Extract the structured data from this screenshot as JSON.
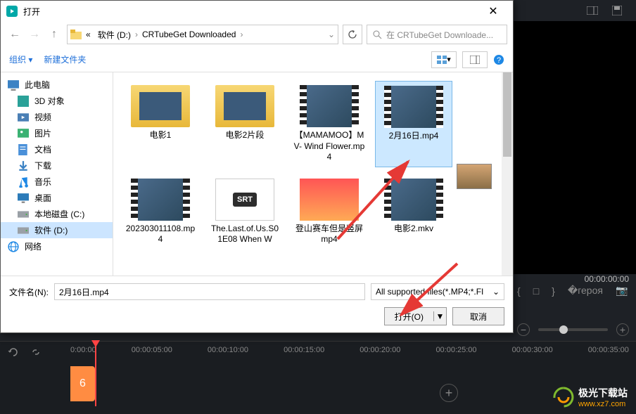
{
  "dialog": {
    "title": "打开",
    "path": {
      "drive_glyph": "«",
      "drive": "软件 (D:)",
      "folder": "CRTubeGet Downloaded"
    },
    "search_placeholder": "在 CRTubeGet Downloade...",
    "toolbar": {
      "organize": "组织",
      "new_folder": "新建文件夹"
    },
    "sidebar": [
      {
        "label": "此电脑",
        "icon": "pc",
        "lvl": 1
      },
      {
        "label": "3D 对象",
        "icon": "3d"
      },
      {
        "label": "视频",
        "icon": "video"
      },
      {
        "label": "图片",
        "icon": "image"
      },
      {
        "label": "文档",
        "icon": "doc"
      },
      {
        "label": "下载",
        "icon": "download"
      },
      {
        "label": "音乐",
        "icon": "music"
      },
      {
        "label": "桌面",
        "icon": "desktop"
      },
      {
        "label": "本地磁盘 (C:)",
        "icon": "disk"
      },
      {
        "label": "软件 (D:)",
        "icon": "disk",
        "selected": true
      },
      {
        "label": "网络",
        "icon": "net",
        "lvl": 1
      }
    ],
    "files": [
      {
        "label": "电影1",
        "type": "folder"
      },
      {
        "label": "电影2片段",
        "type": "folder"
      },
      {
        "label": "【MAMAMOO】MV- Wind Flower.mp4",
        "type": "video"
      },
      {
        "label": "2月16日.mp4",
        "type": "video",
        "selected": true
      },
      {
        "label": "202303011108.mp4",
        "type": "video"
      },
      {
        "label": "The.Last.of.Us.S01E08 When W",
        "type": "srt"
      },
      {
        "label": "登山赛车但是竖屏   mp4",
        "type": "image"
      },
      {
        "label": "电影2.mkv",
        "type": "video"
      }
    ],
    "filename_label": "文件名(N):",
    "filename_value": "2月16日.mp4",
    "filter": "All supported files(*.MP4;*.FI",
    "open_btn": "打开(O)",
    "cancel_btn": "取消"
  },
  "editor": {
    "quality": "质",
    "timecode": "00:00:00:00",
    "ticks": [
      "0:00:00",
      "00:00:05:00",
      "00:00:10:00",
      "00:00:15:00",
      "00:00:20:00",
      "00:00:25:00",
      "00:00:30:00",
      "00:00:35:00"
    ],
    "watermark_name": "极光下载站",
    "watermark_url": "www.xz7.com",
    "track_clip": "6"
  }
}
